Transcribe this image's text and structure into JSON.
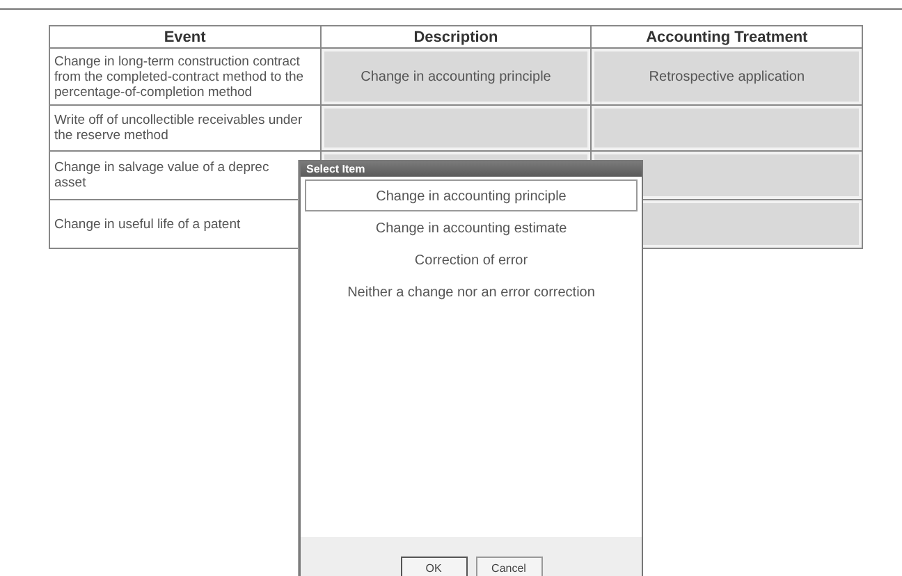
{
  "table": {
    "columns": [
      "Event",
      "Description",
      "Accounting Treatment"
    ],
    "rows": [
      {
        "event": "Change in long-term construction contract from the completed-contract method to the percentage-of-completion method",
        "description": "Change in accounting principle",
        "treatment": "Retrospective application"
      },
      {
        "event": "Write off of uncollectible receivables under the reserve method"
      },
      {
        "event": "Change in salvage value of a deprec\nasset"
      },
      {
        "event": "Change in useful life of a patent"
      }
    ]
  },
  "dialog": {
    "title": "Select Item",
    "options": [
      {
        "label": "Change in accounting principle",
        "selected": true
      },
      {
        "label": "Change in accounting estimate",
        "selected": false
      },
      {
        "label": "Correction of error",
        "selected": false
      },
      {
        "label": "Neither a change nor an error correction",
        "selected": false
      }
    ],
    "buttons": [
      "OK",
      "Cancel"
    ]
  }
}
